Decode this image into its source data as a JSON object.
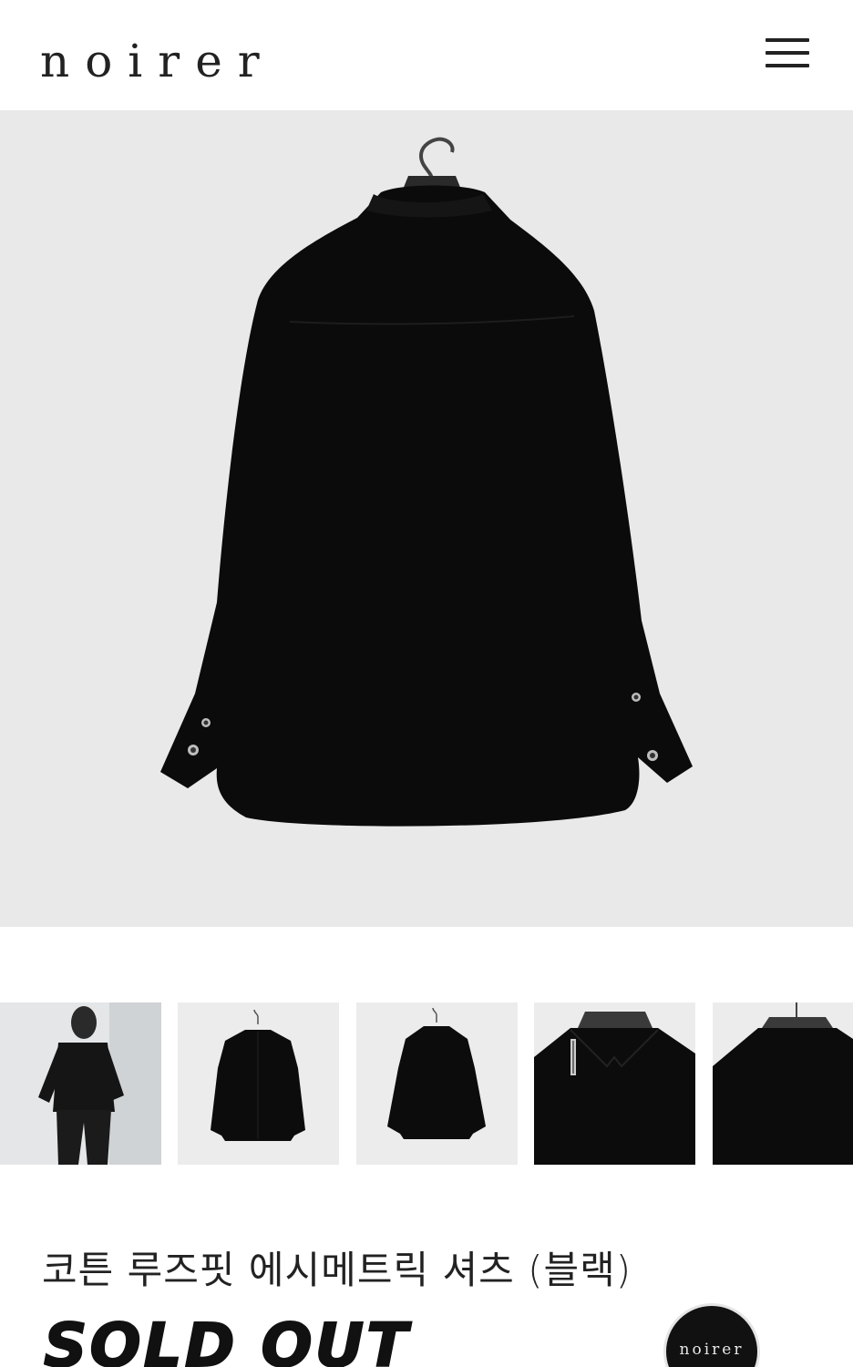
{
  "header": {
    "logo": "noirer",
    "close_icon": "close-icon",
    "menu_icon": "hamburger-menu-icon"
  },
  "gallery": {
    "main_image": "black-shirt-back-on-hanger",
    "thumbnails": [
      {
        "name": "model-wearing-black-shirt"
      },
      {
        "name": "black-shirt-front"
      },
      {
        "name": "black-shirt-back"
      },
      {
        "name": "black-shirt-collar-detail"
      },
      {
        "name": "black-shirt-back-collar-detail"
      }
    ]
  },
  "product": {
    "title": "코튼 루즈핏 에시메트릭 셔츠 (블랙)",
    "status": "SOLD OUT"
  },
  "floating_button": {
    "label": "noirer"
  },
  "colors": {
    "background": "#ffffff",
    "photo_bg": "#e9e9e9",
    "garment": "#0b0b0b",
    "text": "#222222"
  }
}
